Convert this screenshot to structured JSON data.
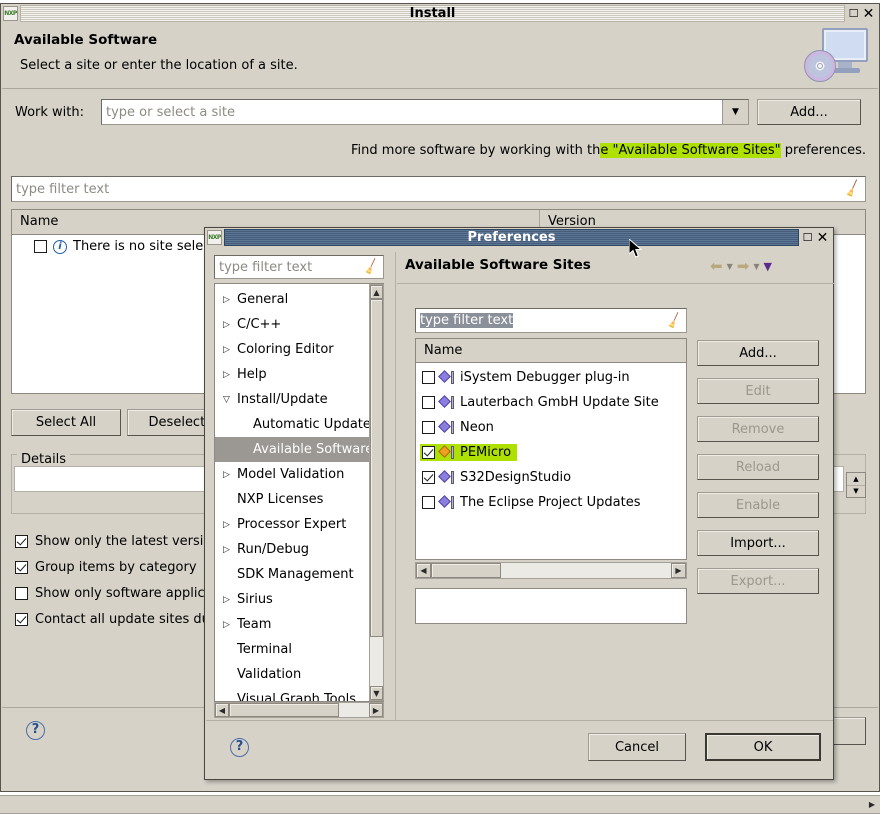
{
  "install_window": {
    "title": "Install",
    "icon_label": "NXP",
    "titlebar_buttons": [
      "maximize-icon",
      "close-icon"
    ],
    "header": {
      "heading": "Available Software",
      "subheading": "Select a site or enter the location of a site.",
      "banner_icon": "install-monitor-cd-icon"
    },
    "work_with": {
      "label": "Work with:",
      "value": "",
      "placeholder": "type or select a site",
      "dropdown_icon": "chevron-down-icon",
      "add_button": "Add..."
    },
    "hint": {
      "prefix": "Find more software by working with th",
      "highlight": "e \"Available Software Sites\"",
      "suffix": " preferences."
    },
    "filter": {
      "placeholder": "type filter text",
      "clear_icon": "broom-icon"
    },
    "table": {
      "columns": [
        "Name",
        "Version"
      ],
      "rows": [
        {
          "label": "There is no site selected.",
          "checked": false,
          "icon": "info-icon"
        }
      ]
    },
    "buttons": {
      "select_all": "Select All",
      "deselect_all": "Deselect All"
    },
    "details": {
      "legend": "Details",
      "value": ""
    },
    "options": [
      {
        "label": "Show only the latest versions of available software",
        "checked": true
      },
      {
        "label": "Group items by category",
        "checked": true
      },
      {
        "label": "Show only software applicable to target environment",
        "checked": false
      },
      {
        "label": "Contact all update sites during install to find required software",
        "checked": true
      }
    ],
    "help_icon": "help-question-icon"
  },
  "preferences_window": {
    "title": "Preferences",
    "icon_label": "NXP",
    "titlebar_buttons": [
      "maximize-icon",
      "close-icon"
    ],
    "tree_filter": {
      "placeholder": "type filter text",
      "clear_icon": "broom-icon"
    },
    "tree": [
      {
        "label": "General",
        "twisty": "collapsed",
        "indent": 0,
        "selected": false
      },
      {
        "label": "C/C++",
        "twisty": "collapsed",
        "indent": 0,
        "selected": false
      },
      {
        "label": "Coloring Editor",
        "twisty": "collapsed",
        "indent": 0,
        "selected": false
      },
      {
        "label": "Help",
        "twisty": "collapsed",
        "indent": 0,
        "selected": false
      },
      {
        "label": "Install/Update",
        "twisty": "expanded",
        "indent": 0,
        "selected": false
      },
      {
        "label": "Automatic Updates",
        "twisty": "none",
        "indent": 1,
        "selected": false
      },
      {
        "label": "Available Software Sites",
        "twisty": "none",
        "indent": 1,
        "selected": true
      },
      {
        "label": "Model Validation",
        "twisty": "collapsed",
        "indent": 0,
        "selected": false
      },
      {
        "label": "NXP Licenses",
        "twisty": "none",
        "indent": 0,
        "selected": false
      },
      {
        "label": "Processor Expert",
        "twisty": "collapsed",
        "indent": 0,
        "selected": false
      },
      {
        "label": "Run/Debug",
        "twisty": "collapsed",
        "indent": 0,
        "selected": false
      },
      {
        "label": "SDK Management",
        "twisty": "none",
        "indent": 0,
        "selected": false
      },
      {
        "label": "Sirius",
        "twisty": "collapsed",
        "indent": 0,
        "selected": false
      },
      {
        "label": "Team",
        "twisty": "collapsed",
        "indent": 0,
        "selected": false
      },
      {
        "label": "Terminal",
        "twisty": "none",
        "indent": 0,
        "selected": false
      },
      {
        "label": "Validation",
        "twisty": "none",
        "indent": 0,
        "selected": false
      },
      {
        "label": "Visual Graph Tools",
        "twisty": "none",
        "indent": 0,
        "selected": false
      }
    ],
    "page": {
      "title": "Available Software Sites",
      "nav": {
        "back_icon": "arrow-left-icon",
        "back_menu_icon": "chevron-down-icon",
        "forward_icon": "arrow-right-icon",
        "forward_menu_icon": "chevron-down-icon",
        "view_menu_icon": "triangle-down-icon"
      },
      "filter": {
        "value": "type filter text",
        "selected": true,
        "clear_icon": "broom-icon"
      },
      "table": {
        "column": "Name",
        "rows": [
          {
            "label": "iSystem Debugger plug-in",
            "checked": false,
            "highlighted": false,
            "icon": "update-site-icon"
          },
          {
            "label": "Lauterbach GmbH Update Site",
            "checked": false,
            "highlighted": false,
            "icon": "update-site-icon"
          },
          {
            "label": "Neon",
            "checked": false,
            "highlighted": false,
            "icon": "update-site-icon"
          },
          {
            "label": "PEMicro",
            "checked": true,
            "highlighted": true,
            "icon": "update-site-icon"
          },
          {
            "label": "S32DesignStudio",
            "checked": true,
            "highlighted": false,
            "icon": "update-site-icon"
          },
          {
            "label": "The Eclipse Project Updates",
            "checked": false,
            "highlighted": false,
            "icon": "update-site-icon"
          }
        ]
      },
      "side_buttons": [
        {
          "label": "Add...",
          "enabled": true
        },
        {
          "label": "Edit",
          "enabled": false
        },
        {
          "label": "Remove",
          "enabled": false
        },
        {
          "label": "Reload",
          "enabled": false
        },
        {
          "label": "Enable",
          "enabled": false
        },
        {
          "label": "Import...",
          "enabled": true
        },
        {
          "label": "Export...",
          "enabled": false
        }
      ],
      "detail_box": ""
    },
    "footer": {
      "help_icon": "help-question-icon",
      "cancel": "Cancel",
      "ok": "OK"
    }
  },
  "colors": {
    "window_bg": "#d6d2c8",
    "titlebar_active": "#4f6785",
    "titlebar_inactive": "#cdc9bf",
    "highlight_green": "#aee000",
    "selection_grey": "#9b9792",
    "text": "#000000",
    "disabled_text": "#9b978e"
  }
}
